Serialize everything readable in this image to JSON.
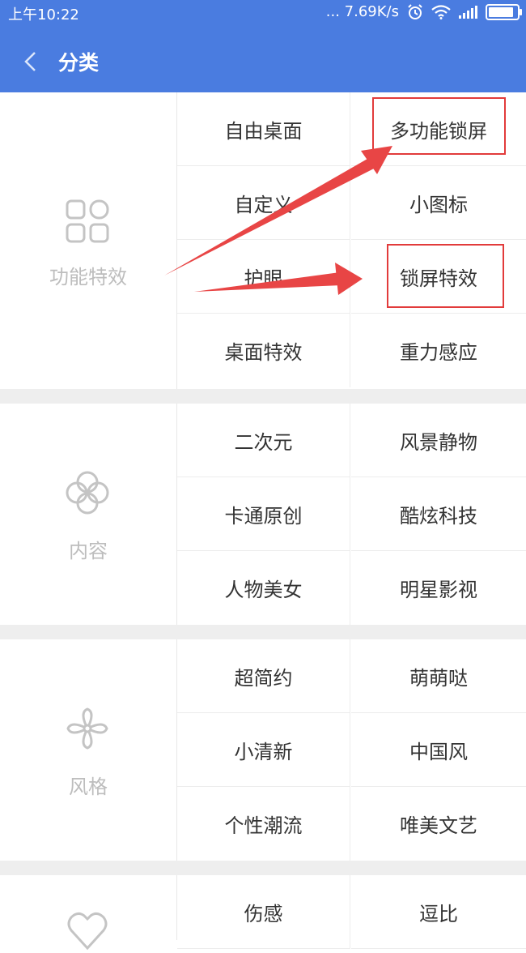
{
  "status_bar": {
    "time": "上午10:22",
    "network_speed": "... 7.69K/s"
  },
  "header": {
    "title": "分类"
  },
  "categories": [
    {
      "label": "功能特效",
      "icon": "grid-icon",
      "items": [
        "自由桌面",
        "多功能锁屏",
        "自定义",
        "小图标",
        "护眼",
        "锁屏特效",
        "桌面特效",
        "重力感应"
      ]
    },
    {
      "label": "内容",
      "icon": "clover-icon",
      "items": [
        "二次元",
        "风景静物",
        "卡通原创",
        "酷炫科技",
        "人物美女",
        "明星影视"
      ]
    },
    {
      "label": "风格",
      "icon": "pinwheel-icon",
      "items": [
        "超简约",
        "萌萌哒",
        "小清新",
        "中国风",
        "个性潮流",
        "唯美文艺"
      ]
    },
    {
      "label": "",
      "icon": "heart-icon",
      "items": [
        "伤感",
        "逗比"
      ]
    }
  ],
  "colors": {
    "header_bg": "#4a7ce0",
    "highlight": "#e23b3b",
    "arrow": "#e84545"
  }
}
